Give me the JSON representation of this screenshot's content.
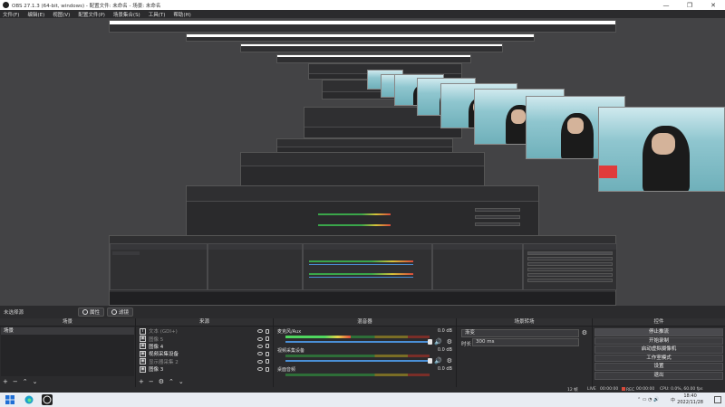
{
  "window": {
    "title": "OBS 27.1.3 (64-bit, windows) - 配置文件: 未命名 - 场景: 未命名",
    "minimize": "—",
    "maximize": "❐",
    "close": "✕"
  },
  "menu": [
    "文件(F)",
    "编辑(E)",
    "视图(V)",
    "配置文件(P)",
    "场景集合(S)",
    "工具(T)",
    "帮助(H)"
  ],
  "toolbar": {
    "no_source": "未选择源",
    "properties": "属性",
    "filters": "滤镜"
  },
  "scenes": {
    "header": "场景",
    "items": [
      "场景"
    ]
  },
  "sources": {
    "header": "来源",
    "items": [
      {
        "name": "文本 (GDI+)",
        "icon": "T",
        "dim": true
      },
      {
        "name": "图像 5",
        "icon": "▣",
        "dim": true
      },
      {
        "name": "图像 4",
        "icon": "▣",
        "dim": false
      },
      {
        "name": "视频采集设备",
        "icon": "▣",
        "dim": false
      },
      {
        "name": "显示器采集 2",
        "icon": "▣",
        "dim": true
      },
      {
        "name": "图像 3",
        "icon": "▣",
        "dim": false
      }
    ]
  },
  "mixer": {
    "header": "混音器",
    "channels": [
      {
        "name": "麦克风/Aux",
        "db": "0.0 dB",
        "level": 0.45
      },
      {
        "name": "视频采集设备",
        "db": "0.0 dB",
        "level": 0.0
      },
      {
        "name": "桌面音频",
        "db": "0.0 dB",
        "level": 0.0
      }
    ]
  },
  "transitions": {
    "header": "场景转场",
    "type": "渐变",
    "duration_label": "时长",
    "duration_value": "300 ms"
  },
  "controls": {
    "header": "控件",
    "buttons": [
      "停止推流",
      "开始录制",
      "启动虚拟摄像机",
      "工作室模式",
      "设置",
      "退出"
    ]
  },
  "status": {
    "live_label": "LIVE",
    "live_time": "00:00:00",
    "rec_label": "REC",
    "rec_time": "00:00:00",
    "cpu": "CPU: 0.0%, 60.00 fps",
    "dropped": "12 帧",
    "kbps": "0 kb/s"
  },
  "taskbar": {
    "time": "18:40",
    "date": "2022/11/28",
    "ime": "中"
  },
  "colors": {
    "accent": "#4a8fd6",
    "rec": "#d84a3a",
    "meter_green": "#4fd65e",
    "meter_yellow": "#e9d54a",
    "meter_red": "#e24c3c"
  }
}
